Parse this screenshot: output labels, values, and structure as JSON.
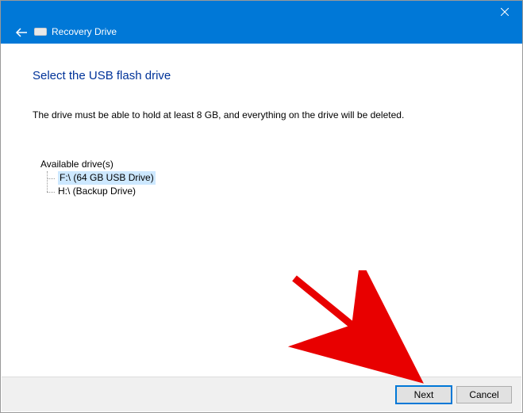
{
  "titlebar": {
    "title": "Recovery Drive"
  },
  "content": {
    "heading": "Select the USB flash drive",
    "instruction": "The drive must be able to hold at least 8 GB, and everything on the drive will be deleted.",
    "drives_label": "Available drive(s)",
    "drives": [
      {
        "label": "F:\\ (64 GB USB Drive)",
        "selected": true
      },
      {
        "label": "H:\\ (Backup Drive)",
        "selected": false
      }
    ]
  },
  "footer": {
    "next": "Next",
    "cancel": "Cancel"
  }
}
